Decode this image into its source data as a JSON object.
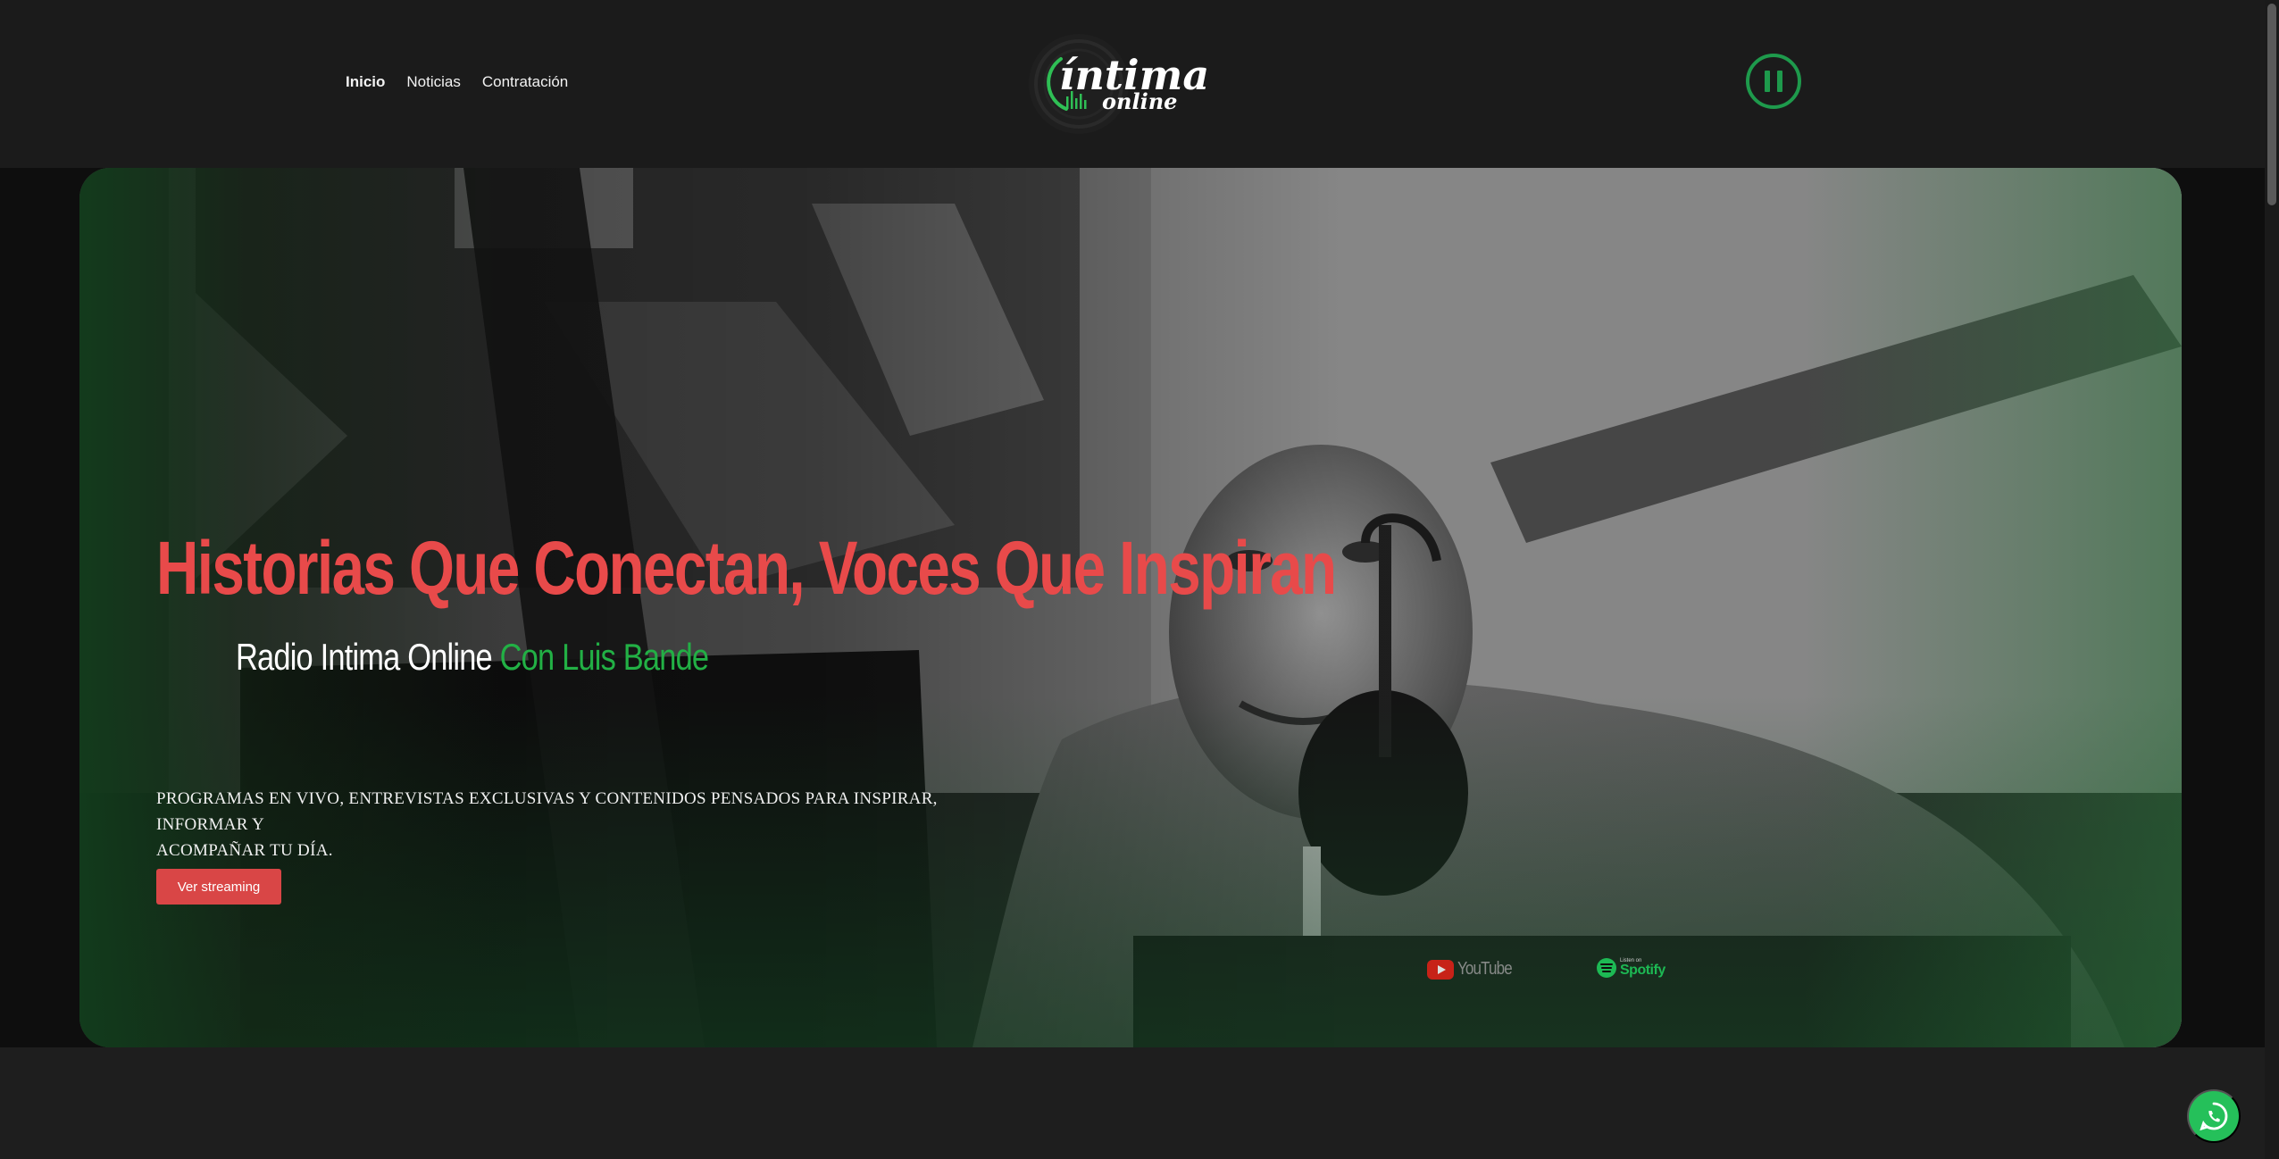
{
  "header": {
    "nav": [
      {
        "label": "Inicio",
        "active": true
      },
      {
        "label": "Noticias",
        "active": false
      },
      {
        "label": "Contratación",
        "active": false
      }
    ],
    "logo": {
      "line1": "íntima",
      "line2": "online"
    },
    "player_state": "playing",
    "accent_color": "#1e9a4c"
  },
  "hero": {
    "subtitle_white": "Radio Intima Online",
    "subtitle_green": "Con Luis Bande",
    "title": "Historias Que Conectan, Voces Que Inspiran",
    "description_line1": "Programas en vivo, entrevistas exclusivas y contenidos pensados para inspirar, informar y",
    "description_line2": "acompañar tu día.",
    "button_label": "Ver streaming",
    "badges": {
      "youtube": "YouTube",
      "spotify_small": "Listen on",
      "spotify": "Spotify"
    },
    "colors": {
      "title": "#e84a4a",
      "subtitle_green": "#22b045",
      "button": "#d94646"
    }
  },
  "floating": {
    "whatsapp_icon": "whatsapp-icon"
  }
}
